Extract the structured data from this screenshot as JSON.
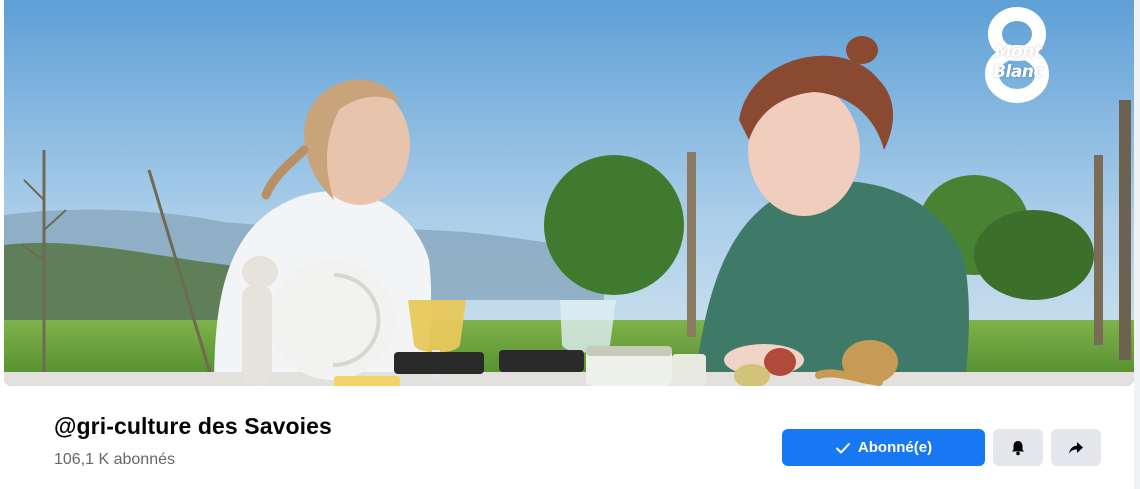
{
  "cover": {
    "channel_logo_text": "Mont Blanc",
    "channel_logo_number": "8"
  },
  "profile": {
    "title": "@gri-culture des Savoies",
    "followers": "106,1 K abonnés"
  },
  "actions": {
    "follow_label": "Abonné(e)",
    "bell_icon": "bell-icon",
    "share_icon": "share-arrow-icon"
  },
  "colors": {
    "primary_button": "#1877f2",
    "secondary_button": "#e4e6eb",
    "title_text": "#050505",
    "muted_text": "#65676b"
  }
}
